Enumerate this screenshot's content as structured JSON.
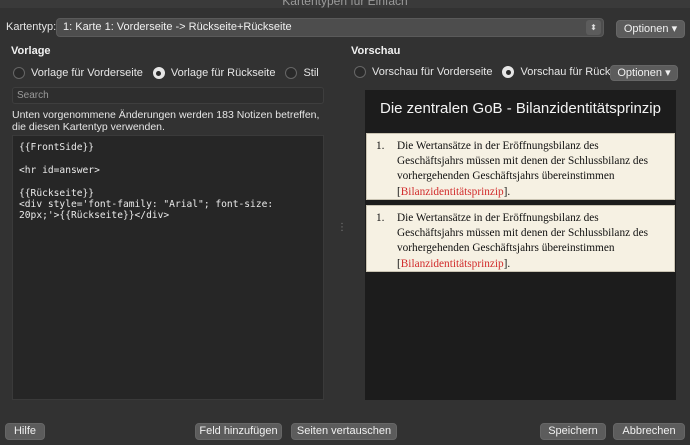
{
  "window": {
    "title": "Kartentypen für Einfach"
  },
  "cardtype": {
    "label": "Kartentyp:",
    "selected": "1: Karte 1: Vorderseite -> Rückseite+Rückseite",
    "options_button": "Optionen ▾"
  },
  "template": {
    "section_title": "Vorlage",
    "radios": [
      {
        "label": "Vorlage für Vorderseite",
        "selected": false
      },
      {
        "label": "Vorlage für Rückseite",
        "selected": true
      },
      {
        "label": "Stil",
        "selected": false
      }
    ],
    "search_placeholder": "Search",
    "info": "Unten vorgenommene Änderungen werden 183 Notizen betreffen, die diesen Kartentyp verwenden.",
    "code": "{{FrontSide}}\n\n<hr id=answer>\n\n{{Rückseite}}\n<div style='font-family: \"Arial\"; font-size: 20px;'>{{Rückseite}}</div>"
  },
  "preview": {
    "section_title": "Vorschau",
    "radios": [
      {
        "label": "Vorschau für Vorderseite",
        "selected": false
      },
      {
        "label": "Vorschau für Rückseite",
        "selected": true
      }
    ],
    "options_button": "Optionen ▾",
    "heading": "Die zentralen GoB - Bilanzidentitätsprinzip",
    "items": [
      {
        "number": "1.",
        "text": "Die Wertansätze in der Eröffnungsbilanz des Geschäftsjahrs müssen mit denen der Schlussbilanz des vorhergehenden Geschäftsjahrs übereinstimmen",
        "link": "Bilanzidentitätsprinzip"
      },
      {
        "number": "1.",
        "text": "Die Wertansätze in der Eröffnungsbilanz des Geschäftsjahrs müssen mit denen der Schlussbilanz des vorhergehenden Geschäftsjahrs übereinstimmen",
        "link": "Bilanzidentitätsprinzip"
      }
    ]
  },
  "footer": {
    "help": "Hilfe",
    "add_field": "Feld hinzufügen",
    "swap_sides": "Seiten vertauschen",
    "save": "Speichern",
    "cancel": "Abbrechen"
  }
}
